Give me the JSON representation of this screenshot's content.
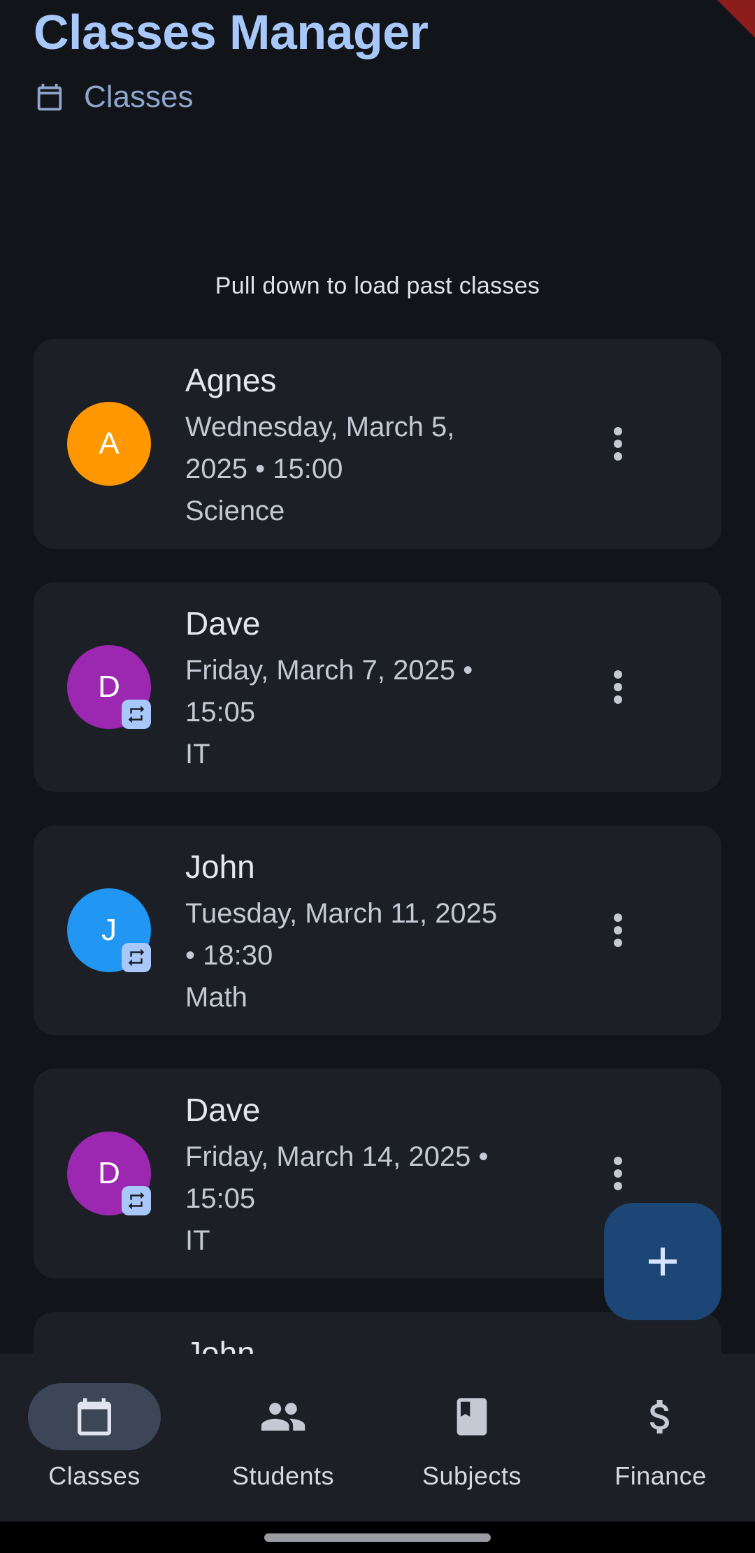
{
  "header": {
    "title": "Classes Manager",
    "subtitle": "Classes",
    "subtitle_icon": "calendar-icon"
  },
  "hint": "Pull down to load past classes",
  "classes": [
    {
      "initial": "A",
      "name": "Agnes",
      "line1": "Wednesday, March 5,",
      "line2": "2025 • 15:00",
      "subject": "Science",
      "avatar_color": "#ff9800",
      "recurring": false
    },
    {
      "initial": "D",
      "name": "Dave",
      "line1": "Friday, March 7, 2025 •",
      "line2": "15:05",
      "subject": "IT",
      "avatar_color": "#9c27b0",
      "recurring": true
    },
    {
      "initial": "J",
      "name": "John",
      "line1": "Tuesday, March 11, 2025",
      "line2": "• 18:30",
      "subject": "Math",
      "avatar_color": "#2196f3",
      "recurring": true
    },
    {
      "initial": "D",
      "name": "Dave",
      "line1": "Friday, March 14, 2025 •",
      "line2": "15:05",
      "subject": "IT",
      "avatar_color": "#9c27b0",
      "recurring": true
    },
    {
      "name": "John"
    }
  ],
  "fab": {
    "icon": "plus-icon"
  },
  "nav": [
    {
      "label": "Classes",
      "icon": "calendar-icon",
      "active": true
    },
    {
      "label": "Students",
      "icon": "people-icon",
      "active": false
    },
    {
      "label": "Subjects",
      "icon": "book-icon",
      "active": false
    },
    {
      "label": "Finance",
      "icon": "dollar-icon",
      "active": false
    }
  ],
  "colors": {
    "background": "#111418",
    "card": "#1c1f25",
    "accent": "#a8c8fb",
    "fab": "#1b4675"
  }
}
